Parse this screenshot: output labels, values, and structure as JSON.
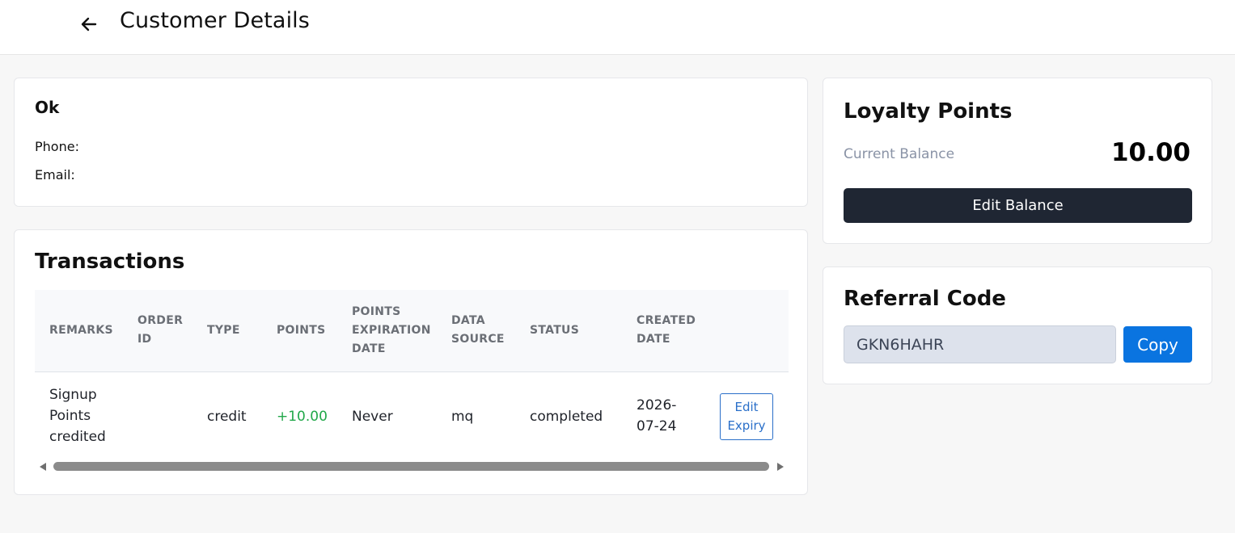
{
  "header": {
    "title": "Customer Details"
  },
  "customer": {
    "name": "Ok",
    "phone_label": "Phone:",
    "email_label": "Email:"
  },
  "transactions": {
    "title": "Transactions",
    "columns": [
      "Remarks",
      "Order ID",
      "Type",
      "Points",
      "Points Expiration Date",
      "Data Source",
      "Status",
      "Created Date"
    ],
    "rows": [
      {
        "remarks": "Signup Points credited",
        "order_id": "",
        "type": "credit",
        "points": "+10.00",
        "points_expiration_date": "Never",
        "data_source": "mq",
        "status": "completed",
        "created_date": "2026-07-24",
        "action_label": "Edit Expiry"
      }
    ]
  },
  "loyalty": {
    "title": "Loyalty Points",
    "balance_label": "Current Balance",
    "balance_value": "10.00",
    "edit_button_label": "Edit Balance"
  },
  "referral": {
    "title": "Referral Code",
    "code": "GKN6HAHR",
    "copy_button_label": "Copy"
  },
  "colors": {
    "points_positive": "#22a84a",
    "primary_button": "#0a74e0",
    "dark_button": "#1f2633",
    "outline_button": "#2a6fc9"
  },
  "icons": {
    "back": "arrow-left-icon"
  }
}
